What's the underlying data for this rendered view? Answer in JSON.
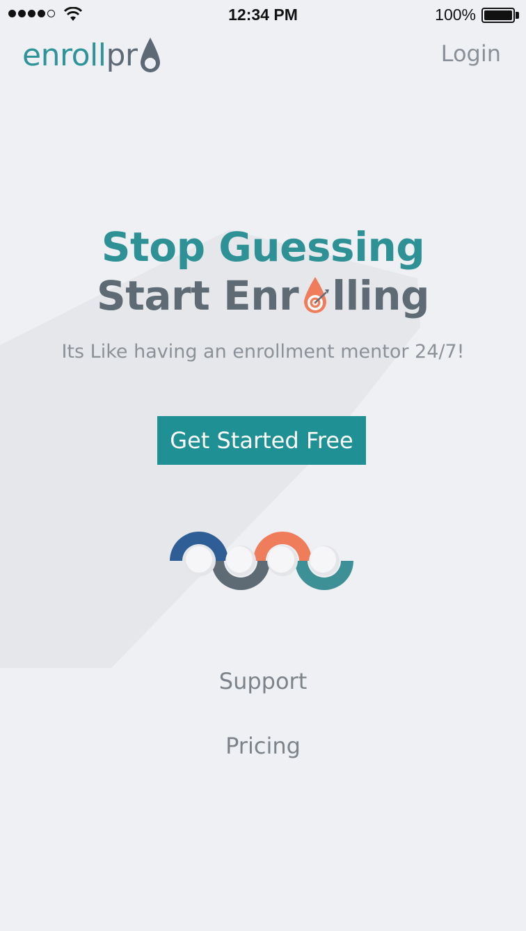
{
  "status_bar": {
    "time": "12:34 PM",
    "battery_percent": "100%",
    "signal_bars_filled": 4,
    "signal_bars_total": 5
  },
  "header": {
    "logo_enroll": "enroll",
    "logo_pro": "pr",
    "login_label": "Login"
  },
  "hero": {
    "headline_line1": "Stop Guessing",
    "headline_line2_a": "Start Enr",
    "headline_line2_b": "lling",
    "tagline": "Its Like having an enrollment mentor 24/7!",
    "cta_label": "Get Started Free"
  },
  "footer": {
    "support_label": "Support",
    "pricing_label": "Pricing"
  },
  "colors": {
    "teal": "#2d9195",
    "slate": "#5e6b75",
    "orange": "#ef7d5c",
    "navy": "#2f5e96",
    "background": "#eff0f4"
  }
}
